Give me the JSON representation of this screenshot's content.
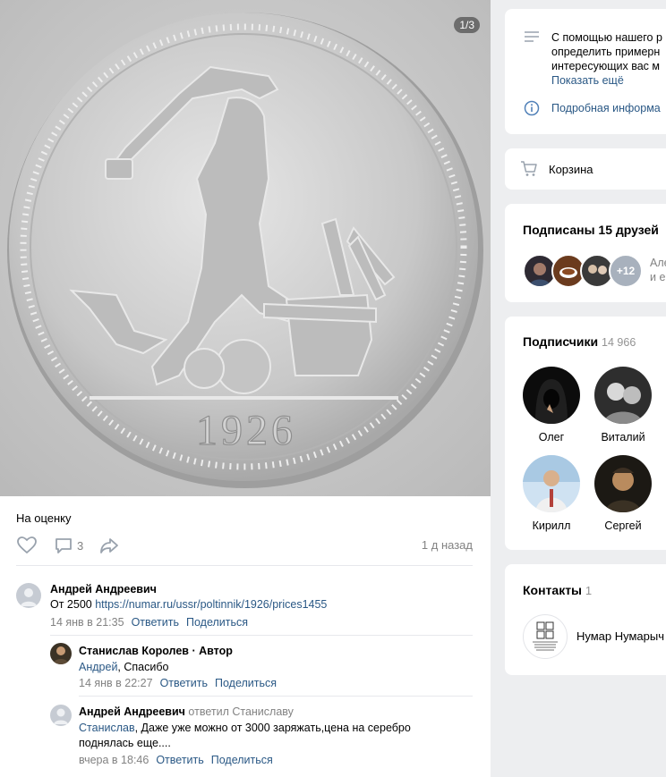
{
  "post": {
    "photo_counter": "1/3",
    "coin_year": "1926",
    "caption": "На оценку",
    "comments_count": "3",
    "time_ago": "1 д назад"
  },
  "comments": [
    {
      "author": "Андрей Андреевич",
      "text_prefix": "От 2500 ",
      "link": "https://numar.ru/ussr/poltinnik/1926/prices1455",
      "time": "14 янв в 21:35",
      "reply": "Ответить",
      "share": "Поделиться"
    },
    {
      "author": "Станислав Королев · Автор",
      "mention": "Андрей",
      "text": ", Спасибо",
      "time": "14 янв в 22:27",
      "reply": "Ответить",
      "share": "Поделиться"
    },
    {
      "author": "Андрей Андреевич",
      "replied": "ответил Станиславу",
      "mention": "Станислав",
      "text_line1": ", Даже уже можно от 3000 заряжать,цена на серебро",
      "text_line2": "поднялась еще....",
      "time": "вчера в 18:46",
      "reply": "Ответить",
      "share": "Поделиться"
    }
  ],
  "sidebar": {
    "info": {
      "line1": "С помощью нашего р",
      "line2": "определить примерн",
      "line3": "интересующих вас м",
      "show_more": "Показать ещё",
      "details": "Подробная информа"
    },
    "cart": {
      "label": "Корзина"
    },
    "friends": {
      "title": "Подписаны 15 друзей",
      "more": "+12",
      "names_line1": "Але",
      "names_line2": "и е"
    },
    "subscribers": {
      "title": "Подписчики",
      "count": "14 966",
      "people": [
        "Олег",
        "Виталий",
        "Кирилл",
        "Сергей"
      ]
    },
    "contacts": {
      "title": "Контакты",
      "count": "1",
      "name": "Нумар Нумарыч"
    }
  },
  "colors": {
    "link": "#2a5885",
    "muted": "#828282",
    "background": "#edeef0"
  }
}
